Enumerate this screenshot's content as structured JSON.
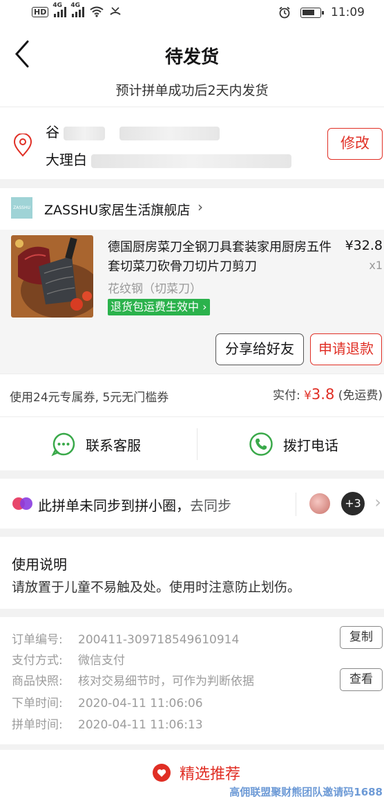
{
  "status_bar": {
    "hd": "HD",
    "net1": "4G",
    "net2": "4G",
    "time": "11:09"
  },
  "header": {
    "title": "待发货",
    "subtitle": "预计拼单成功后2天内发货"
  },
  "address": {
    "name_prefix": "谷",
    "line_prefix": "大理白",
    "edit_label": "修改"
  },
  "store": {
    "logo_text": "ZASSHU",
    "name": "ZASSHU家居生活旗舰店"
  },
  "item": {
    "title": "德国厨房菜刀全钢刀具套装家用厨房五件套切菜刀砍骨刀切片刀剪刀",
    "price": "¥32.8",
    "qty": "x1",
    "spec": "花纹钢（切菜刀）",
    "refund_badge": "退货包运费生效中",
    "share_label": "分享给好友",
    "refund_label": "申请退款"
  },
  "payment": {
    "coupon_text": "使用24元专属券, 5元无门槛券",
    "paid_label": "实付:",
    "currency": "¥",
    "amount": "3.8",
    "shipping": "(免运费)"
  },
  "contact": {
    "service_label": "联系客服",
    "phone_label": "拨打电话"
  },
  "sync": {
    "text": "此拼单未同步到拼小圈，",
    "link": "去同步",
    "more_count": "+3"
  },
  "usage": {
    "heading": "使用说明",
    "text": "请放置于儿童不易触及处。使用时注意防止划伤。"
  },
  "order_info": {
    "rows": [
      {
        "key": "订单编号:",
        "value": "200411-309718549610914"
      },
      {
        "key": "支付方式:",
        "value": "微信支付"
      },
      {
        "key": "商品快照:",
        "value": "核对交易细节时，可作为判断依据"
      },
      {
        "key": "下单时间:",
        "value": "2020-04-11 11:06:06"
      },
      {
        "key": "拼单时间:",
        "value": "2020-04-11 11:06:13"
      }
    ],
    "copy_label": "复制",
    "view_label": "查看"
  },
  "recommend": {
    "title": "精选推荐",
    "watermark": "高佣联盟聚财熊团队邀请码1688"
  },
  "colors": {
    "accent": "#e02e24",
    "green": "#2bb24c",
    "wechat_green": "#3aa94a"
  }
}
